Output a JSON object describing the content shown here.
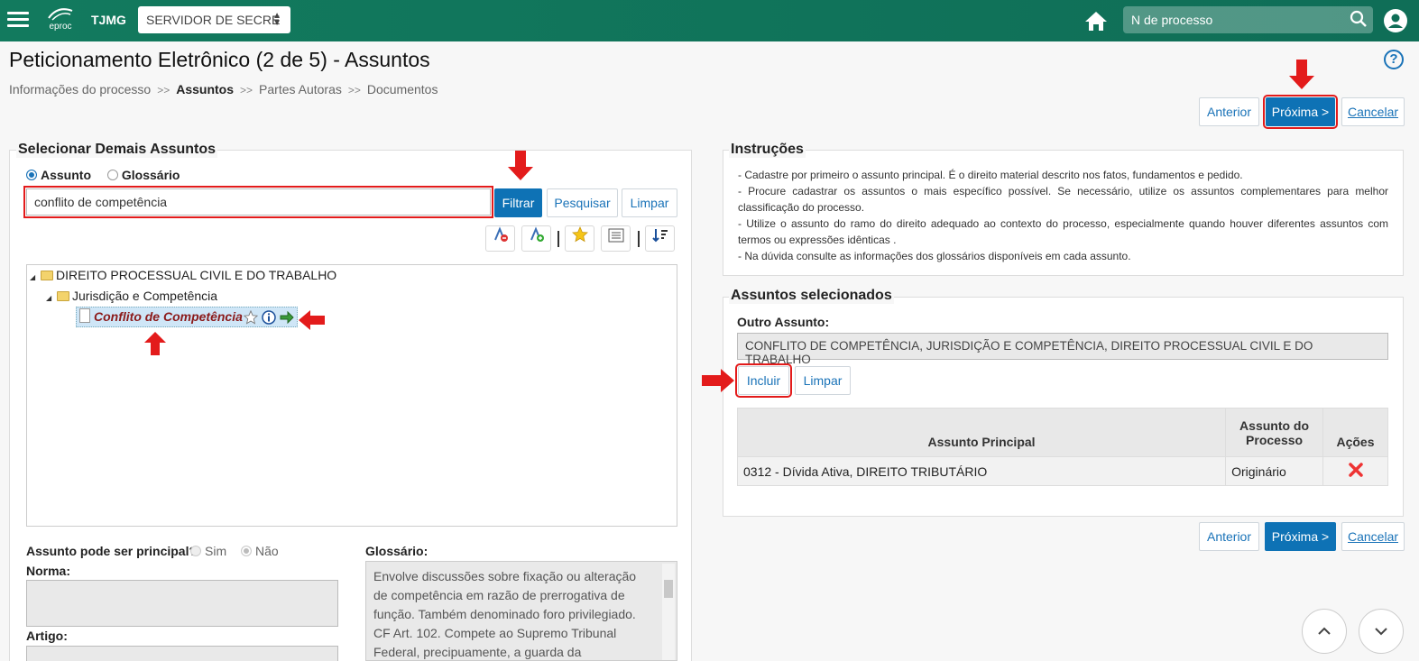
{
  "header": {
    "brand": "TJMG",
    "logo_text": "eproc",
    "server_select": "SERVIDOR DE SECRE",
    "search_placeholder": "N de processo"
  },
  "page": {
    "title": "Peticionamento Eletrônico (2 de 5) - Assuntos",
    "help": "?"
  },
  "breadcrumb": {
    "items": [
      "Informações do processo",
      "Assuntos",
      "Partes Autoras",
      "Documentos"
    ],
    "sep": ">>"
  },
  "nav": {
    "anterior": "Anterior",
    "proxima": "Próxima >",
    "cancelar": "Cancelar"
  },
  "select_panel": {
    "legend": "Selecionar Demais Assuntos",
    "radio_assunto": "Assunto",
    "radio_glossario": "Glossário",
    "search_value": "conflito de competência",
    "filtrar": "Filtrar",
    "pesquisar": "Pesquisar",
    "limpar": "Limpar",
    "tree": {
      "root": "DIREITO PROCESSUAL CIVIL E DO TRABALHO",
      "child": "Jurisdição e Competência",
      "leaf": "Conflito de Competência"
    },
    "principal_label": "Assunto pode ser principal?",
    "sim": "Sim",
    "nao": "Não",
    "norma_label": "Norma:",
    "artigo_label": "Artigo:",
    "glossario_label": "Glossário:",
    "glossario_text": "Envolve discussões sobre fixação ou alteração de competência em razão de prerrogativa de função. Também denominado foro privilegiado. CF Art. 102. Compete ao Supremo Tribunal Federal, precipuamente, a guarda da Constituição,"
  },
  "instrucoes": {
    "legend": "Instruções",
    "lines": [
      "- Cadastre por primeiro o assunto principal. É o direito material descrito nos fatos, fundamentos e pedido.",
      "- Procure cadastrar os assuntos o mais específico possível. Se necessário, utilize os assuntos complementares para melhor classificação do processo.",
      "- Utilize o assunto do ramo do direito adequado ao contexto do processo, especialmente quando houver diferentes assuntos com termos ou expressões idênticas .",
      "- Na dúvida consulte as informações dos glossários disponíveis em cada assunto."
    ]
  },
  "selecionados": {
    "legend": "Assuntos selecionados",
    "outro_label": "Outro Assunto:",
    "outro_value": "CONFLITO DE COMPETÊNCIA, JURISDIÇÃO E COMPETÊNCIA, DIREITO PROCESSUAL CIVIL E DO TRABALHO",
    "incluir": "Incluir",
    "limpar": "Limpar",
    "columns": [
      "Assunto Principal",
      "Assunto do Processo",
      "Ações"
    ],
    "rows": [
      {
        "assunto": "0312 - Dívida Ativa, DIREITO TRIBUTÁRIO",
        "tipo": "Originário"
      }
    ]
  },
  "colors": {
    "topbar": "#127a5e",
    "primary": "#0e72b5",
    "highlight": "#e31b1b",
    "leaf_text": "#8b1a1a"
  }
}
